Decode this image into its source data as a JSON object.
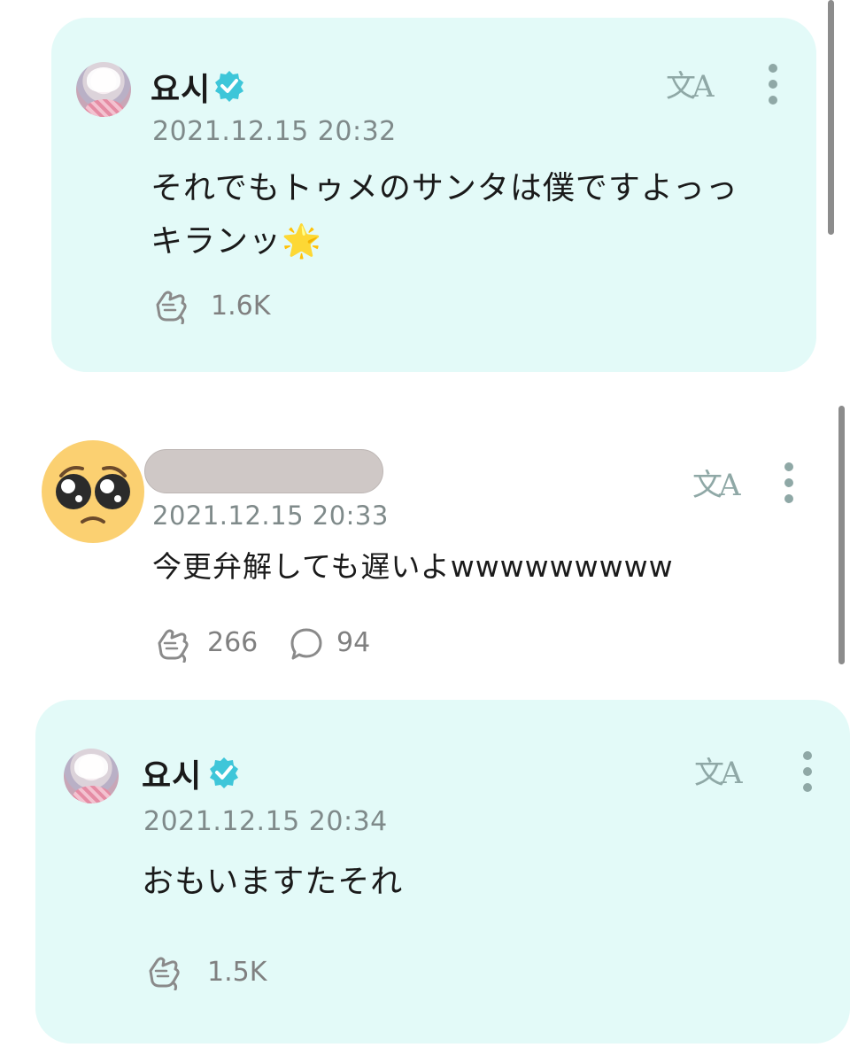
{
  "posts": [
    {
      "author": "요시",
      "verified": true,
      "timestamp": "2021.12.15 20:32",
      "lines": [
        "それでもトゥメのサンタは僕ですよっっ",
        "キランッ"
      ],
      "emoji": "🌟",
      "likes": "1.6K",
      "highlighted": true
    },
    {
      "author": "",
      "author_redacted": true,
      "timestamp": "2021.12.15 20:33",
      "lines": [
        "今更弁解しても遅いよwwwwwwwww"
      ],
      "likes": "266",
      "comments": "94",
      "avatar_icon": "pleading-face-emoji",
      "highlighted": false
    },
    {
      "author": "요시",
      "verified": true,
      "timestamp": "2021.12.15 20:34",
      "lines": [
        "おもいますたそれ"
      ],
      "likes": "1.5K",
      "highlighted": true
    }
  ],
  "icons": {
    "translate": "translate-icon",
    "more": "more-vertical-icon",
    "like": "cheer-hand-icon",
    "comment": "comment-bubble-icon",
    "verified": "verified-badge-icon"
  },
  "translate_glyph": "文A",
  "colors": {
    "card_bg": "#e3faf8",
    "verified_badge": "#3ec6d9",
    "icon_muted": "#8fa8a6",
    "timestamp": "#7f8a8a"
  }
}
